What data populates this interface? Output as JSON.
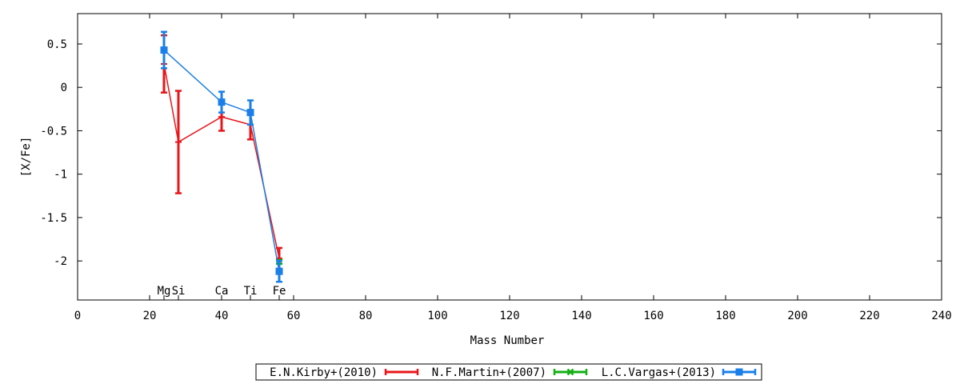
{
  "chart_data": {
    "type": "line",
    "title": "",
    "xlabel": "Mass Number",
    "ylabel": "[X/Fe]",
    "xlim": [
      0,
      240
    ],
    "ylim": [
      -2.45,
      0.85
    ],
    "xticks": [
      0,
      20,
      40,
      60,
      80,
      100,
      120,
      140,
      160,
      180,
      200,
      220,
      240
    ],
    "yticks": [
      0.5,
      0,
      -0.5,
      -1,
      -1.5,
      -2
    ],
    "ytick_labels": [
      "0.5",
      "0",
      "-0.5",
      "-1",
      "-1.5",
      "-2"
    ],
    "grid": false,
    "legend_position": "bottom",
    "element_labels": [
      {
        "text": "Mg",
        "x": 24
      },
      {
        "text": "Si",
        "x": 28
      },
      {
        "text": "Ca",
        "x": 40
      },
      {
        "text": "Ti",
        "x": 48
      },
      {
        "text": "Fe",
        "x": 56
      }
    ],
    "series": [
      {
        "name": "E.N.Kirby+(2010)",
        "color": "#e8161a",
        "points": [
          {
            "x": 24,
            "y": 0.27,
            "err": 0.33
          },
          {
            "x": 28,
            "y": -0.63,
            "err": 0.59
          },
          {
            "x": 40,
            "y": -0.34,
            "err": 0.16
          },
          {
            "x": 48,
            "y": -0.43,
            "err": 0.17
          },
          {
            "x": 56,
            "y": -1.97,
            "err": 0.12
          }
        ]
      },
      {
        "name": "N.F.Martin+(2007)",
        "color": "#15b015",
        "points": [
          {
            "x": 56,
            "y": -2.01,
            "err": 0.02
          }
        ]
      },
      {
        "name": "L.C.Vargas+(2013)",
        "color": "#1a7fe8",
        "points": [
          {
            "x": 24,
            "y": 0.43,
            "err": 0.21
          },
          {
            "x": 40,
            "y": -0.17,
            "err": 0.12
          },
          {
            "x": 48,
            "y": -0.29,
            "err": 0.14
          },
          {
            "x": 56,
            "y": -2.12,
            "err": 0.12
          }
        ]
      }
    ]
  }
}
